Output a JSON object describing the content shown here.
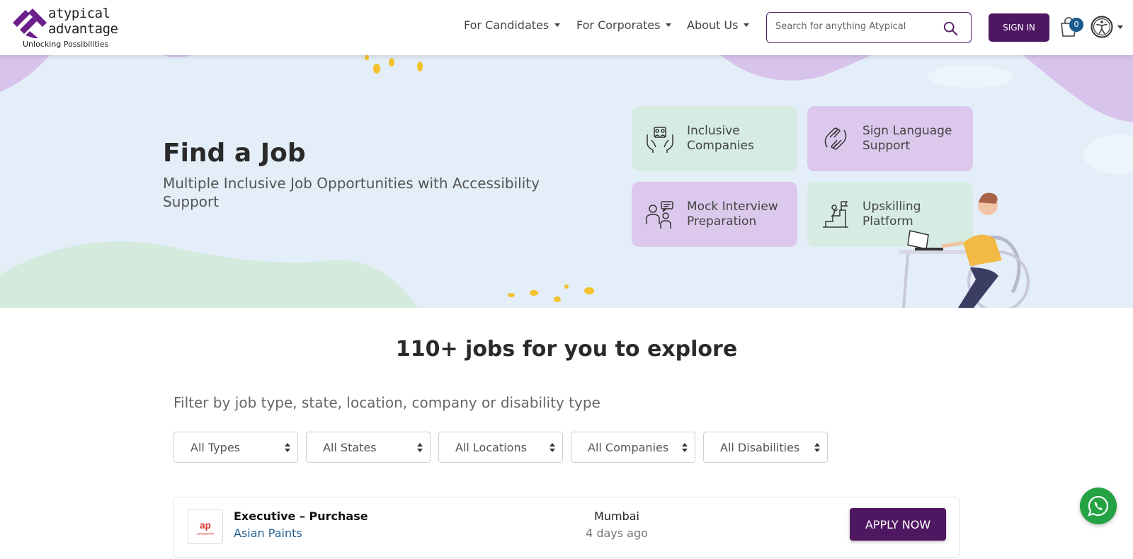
{
  "brand": {
    "name_line1": "atypical",
    "name_line2": "advantage",
    "tagline": "Unlocking Possibilities",
    "primary_color": "#4f1761",
    "accent_purple": "#6b1f8a"
  },
  "nav": {
    "items": [
      {
        "label": "For Candidates"
      },
      {
        "label": "For Corporates"
      },
      {
        "label": "About Us"
      }
    ],
    "search_placeholder": "Search for anything Atypical",
    "signin_label": "SIGN IN",
    "cart_count": "0",
    "icons": [
      "search-icon",
      "cart-icon",
      "accessibility-icon"
    ]
  },
  "hero": {
    "title": "Find a Job",
    "subtitle": "Multiple Inclusive Job Opportunities with Accessibility Support",
    "tiles": [
      {
        "label": "Inclusive Companies",
        "icon": "inclusive-companies-icon"
      },
      {
        "label": "Sign Language Support",
        "icon": "sign-language-icon"
      },
      {
        "label": "Mock Interview Preparation",
        "icon": "mock-interview-icon"
      },
      {
        "label": "Upskilling Platform",
        "icon": "upskilling-icon"
      }
    ]
  },
  "jobs": {
    "heading": "110+ jobs for you to explore",
    "filter_label": "Filter by job type, state, location, company or disability type",
    "filters": [
      {
        "selected": "All Types"
      },
      {
        "selected": "All States"
      },
      {
        "selected": "All Locations"
      },
      {
        "selected": "All Companies"
      },
      {
        "selected": "All Disabilities"
      }
    ],
    "listings": [
      {
        "title": "Executive – Purchase",
        "company": "Asian Paints",
        "location": "Mumbai",
        "posted": "4 days ago",
        "apply_label": "APPLY NOW",
        "logo": "asian-paints-logo"
      }
    ]
  }
}
